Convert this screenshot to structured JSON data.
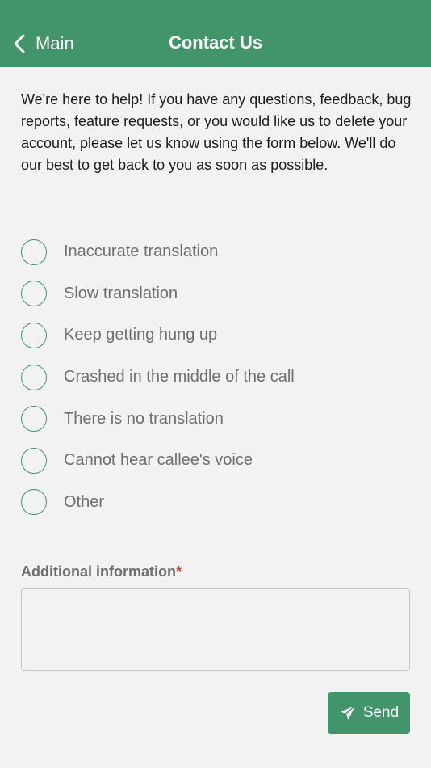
{
  "header": {
    "back_label": "Main",
    "back_icon": "chevron-left-icon",
    "title": "Contact Us",
    "background_color": "#42956b"
  },
  "intro_text": "We're here to help! If you have any questions, feedback, bug reports, feature requests, or you would like us to delete your account, please let us know using the form below. We'll do our best to get back to you as soon as possible.",
  "options": [
    {
      "label": "Inaccurate translation",
      "selected": false
    },
    {
      "label": "Slow translation",
      "selected": false
    },
    {
      "label": "Keep getting hung up",
      "selected": false
    },
    {
      "label": "Crashed in the middle of the call",
      "selected": false
    },
    {
      "label": "There is no translation",
      "selected": false
    },
    {
      "label": "Cannot hear callee's voice",
      "selected": false
    },
    {
      "label": "Other",
      "selected": false
    }
  ],
  "additional_info": {
    "label": "Additional information",
    "required_marker": "*",
    "value": "",
    "placeholder": ""
  },
  "send_button": {
    "label": "Send",
    "icon": "paper-plane-icon"
  },
  "colors": {
    "accent": "#42956b",
    "required": "#d32f2f",
    "background": "#f2f2f2"
  }
}
